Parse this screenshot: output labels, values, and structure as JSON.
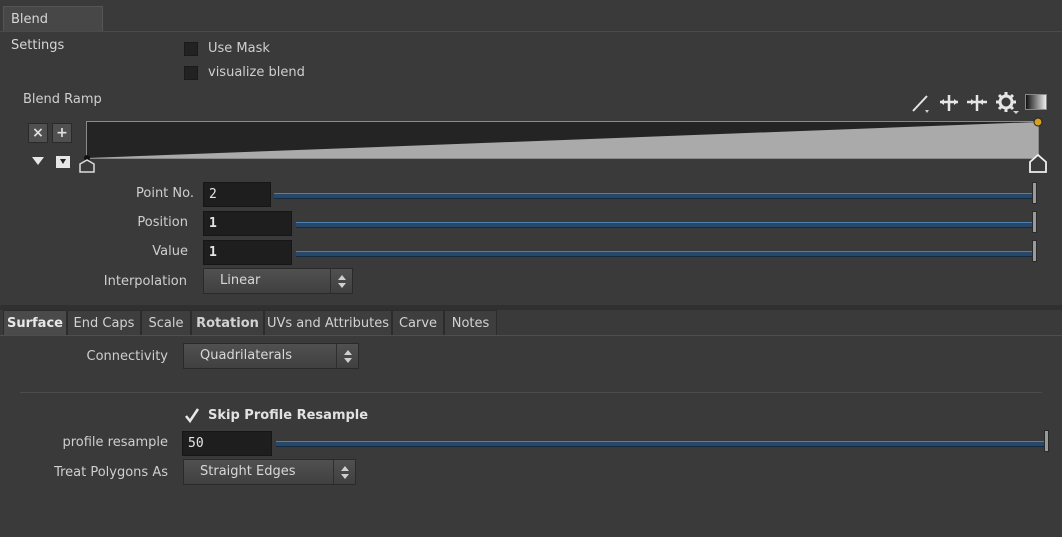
{
  "top_tab": {
    "label": "Blend Settings"
  },
  "options": {
    "use_mask": {
      "label": "Use Mask",
      "checked": false
    },
    "visualize_blend": {
      "label": "visualize blend",
      "checked": false
    }
  },
  "ramp": {
    "label": "Blend Ramp",
    "toolbar_icons": [
      "pen-icon",
      "spread-icon",
      "merge-icon",
      "gear-icon",
      "gradient-icon"
    ],
    "remove_label": "×",
    "add_label": "+",
    "start_value": 0,
    "end_value": 1,
    "point_no_label": "Point No.",
    "point_no_value": "2",
    "point_no_fraction": 1,
    "position_label": "Position",
    "position_value": "1",
    "position_fraction": 1,
    "value_label": "Value",
    "value_value": "1",
    "value_fraction": 1,
    "interpolation_label": "Interpolation",
    "interpolation_value": "Linear"
  },
  "tabs": [
    "Surface",
    "End Caps",
    "Scale",
    "Rotation",
    "UVs and Attributes",
    "Carve",
    "Notes"
  ],
  "active_tab": "Surface",
  "surface": {
    "connectivity_label": "Connectivity",
    "connectivity_value": "Quadrilaterals",
    "skip_profile_label": "Skip Profile Resample",
    "skip_profile_checked": true,
    "profile_resample_label": "profile resample",
    "profile_resample_value": "50",
    "profile_resample_fraction": 1,
    "treat_polygons_label": "Treat Polygons As",
    "treat_polygons_value": "Straight Edges"
  },
  "colors": {
    "background": "#3a3a3a",
    "slider_blue": "#26486a",
    "ramp_fill": "#aaaaaa",
    "ramp_point": "#d4a020"
  }
}
